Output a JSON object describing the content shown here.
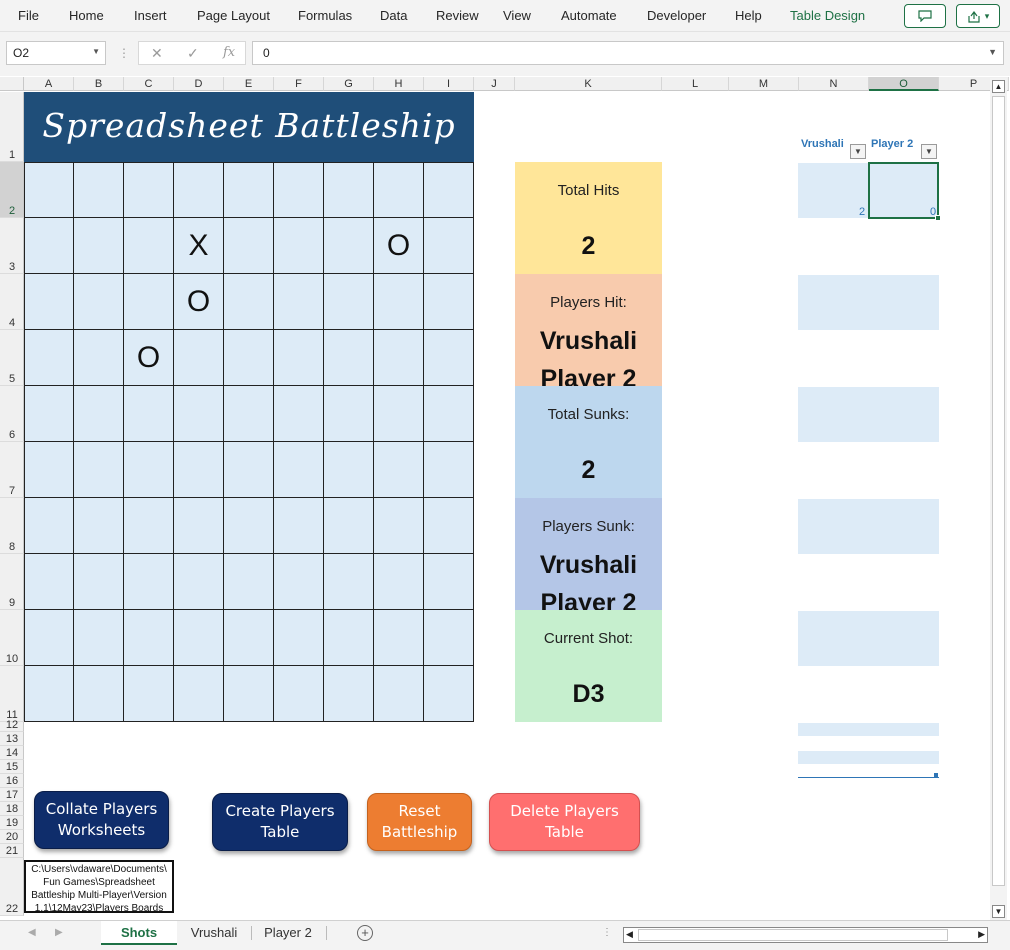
{
  "menu": [
    "File",
    "Home",
    "Insert",
    "Page Layout",
    "Formulas",
    "Data",
    "Review",
    "View",
    "Automate",
    "Developer",
    "Help",
    "Table Design"
  ],
  "top_buttons": {
    "comment_icon": "comment-icon",
    "share_icon": "share-icon"
  },
  "formula_bar": {
    "name_box": "O2",
    "cancel_glyph": "✕",
    "enter_glyph": "✓",
    "fx_glyph": "fx",
    "value": "0"
  },
  "columns": [
    "A",
    "B",
    "C",
    "D",
    "E",
    "F",
    "G",
    "H",
    "I",
    "J",
    "K",
    "L",
    "M",
    "N",
    "O",
    "P"
  ],
  "rows": [
    "1",
    "2",
    "3",
    "4",
    "5",
    "6",
    "7",
    "8",
    "9",
    "10",
    "11",
    "12",
    "13",
    "14",
    "15",
    "16",
    "17",
    "18",
    "19",
    "20",
    "21",
    "22"
  ],
  "selected_cell": {
    "column": "O",
    "row": "2"
  },
  "title": "Spreadsheet Battleship",
  "board": {
    "marks": [
      {
        "cell": "D3",
        "symbol": "X"
      },
      {
        "cell": "H3",
        "symbol": "O"
      },
      {
        "cell": "D4",
        "symbol": "O"
      },
      {
        "cell": "C5",
        "symbol": "O"
      }
    ]
  },
  "stats": {
    "total_hits_label": "Total Hits",
    "total_hits_value": "2",
    "players_hit_label": "Players Hit:",
    "players_hit_1": "Vrushali",
    "players_hit_2": "Player 2",
    "total_sunks_label": "Total Sunks:",
    "total_sunks_value": "2",
    "players_sunk_label": "Players Sunk:",
    "players_sunk_1": "Vrushali",
    "players_sunk_2": "Player 2",
    "current_shot_label": "Current Shot:",
    "current_shot_value": "D3"
  },
  "players_table": {
    "header_1": "Vrushali",
    "header_2": "Player 2",
    "row2_col1": "2",
    "row2_col2": "0"
  },
  "buttons": {
    "collate": "Collate Players\nWorksheets",
    "create": "Create Players\nTable",
    "reset": "Reset\nBattleship",
    "delete": "Delete Players\nTable"
  },
  "path_text": "C:\\Users\\vdaware\\Documents\\ Fun Games\\Spreadsheet Battleship Multi-Player\\Version 1.1\\12May23\\Players Boards",
  "sheet_tabs": [
    "Shots",
    "Vrushali",
    "Player 2"
  ],
  "active_tab": "Shots",
  "colors": {
    "title_bg": "#1f4e79",
    "grid_bg": "#ddebf7",
    "hits": "#ffe699",
    "players_hit": "#f8cbad",
    "sunks": "#bdd7ee",
    "players_sunk": "#b4c6e7",
    "current_shot": "#c6efce",
    "accent": "#1e7145"
  }
}
